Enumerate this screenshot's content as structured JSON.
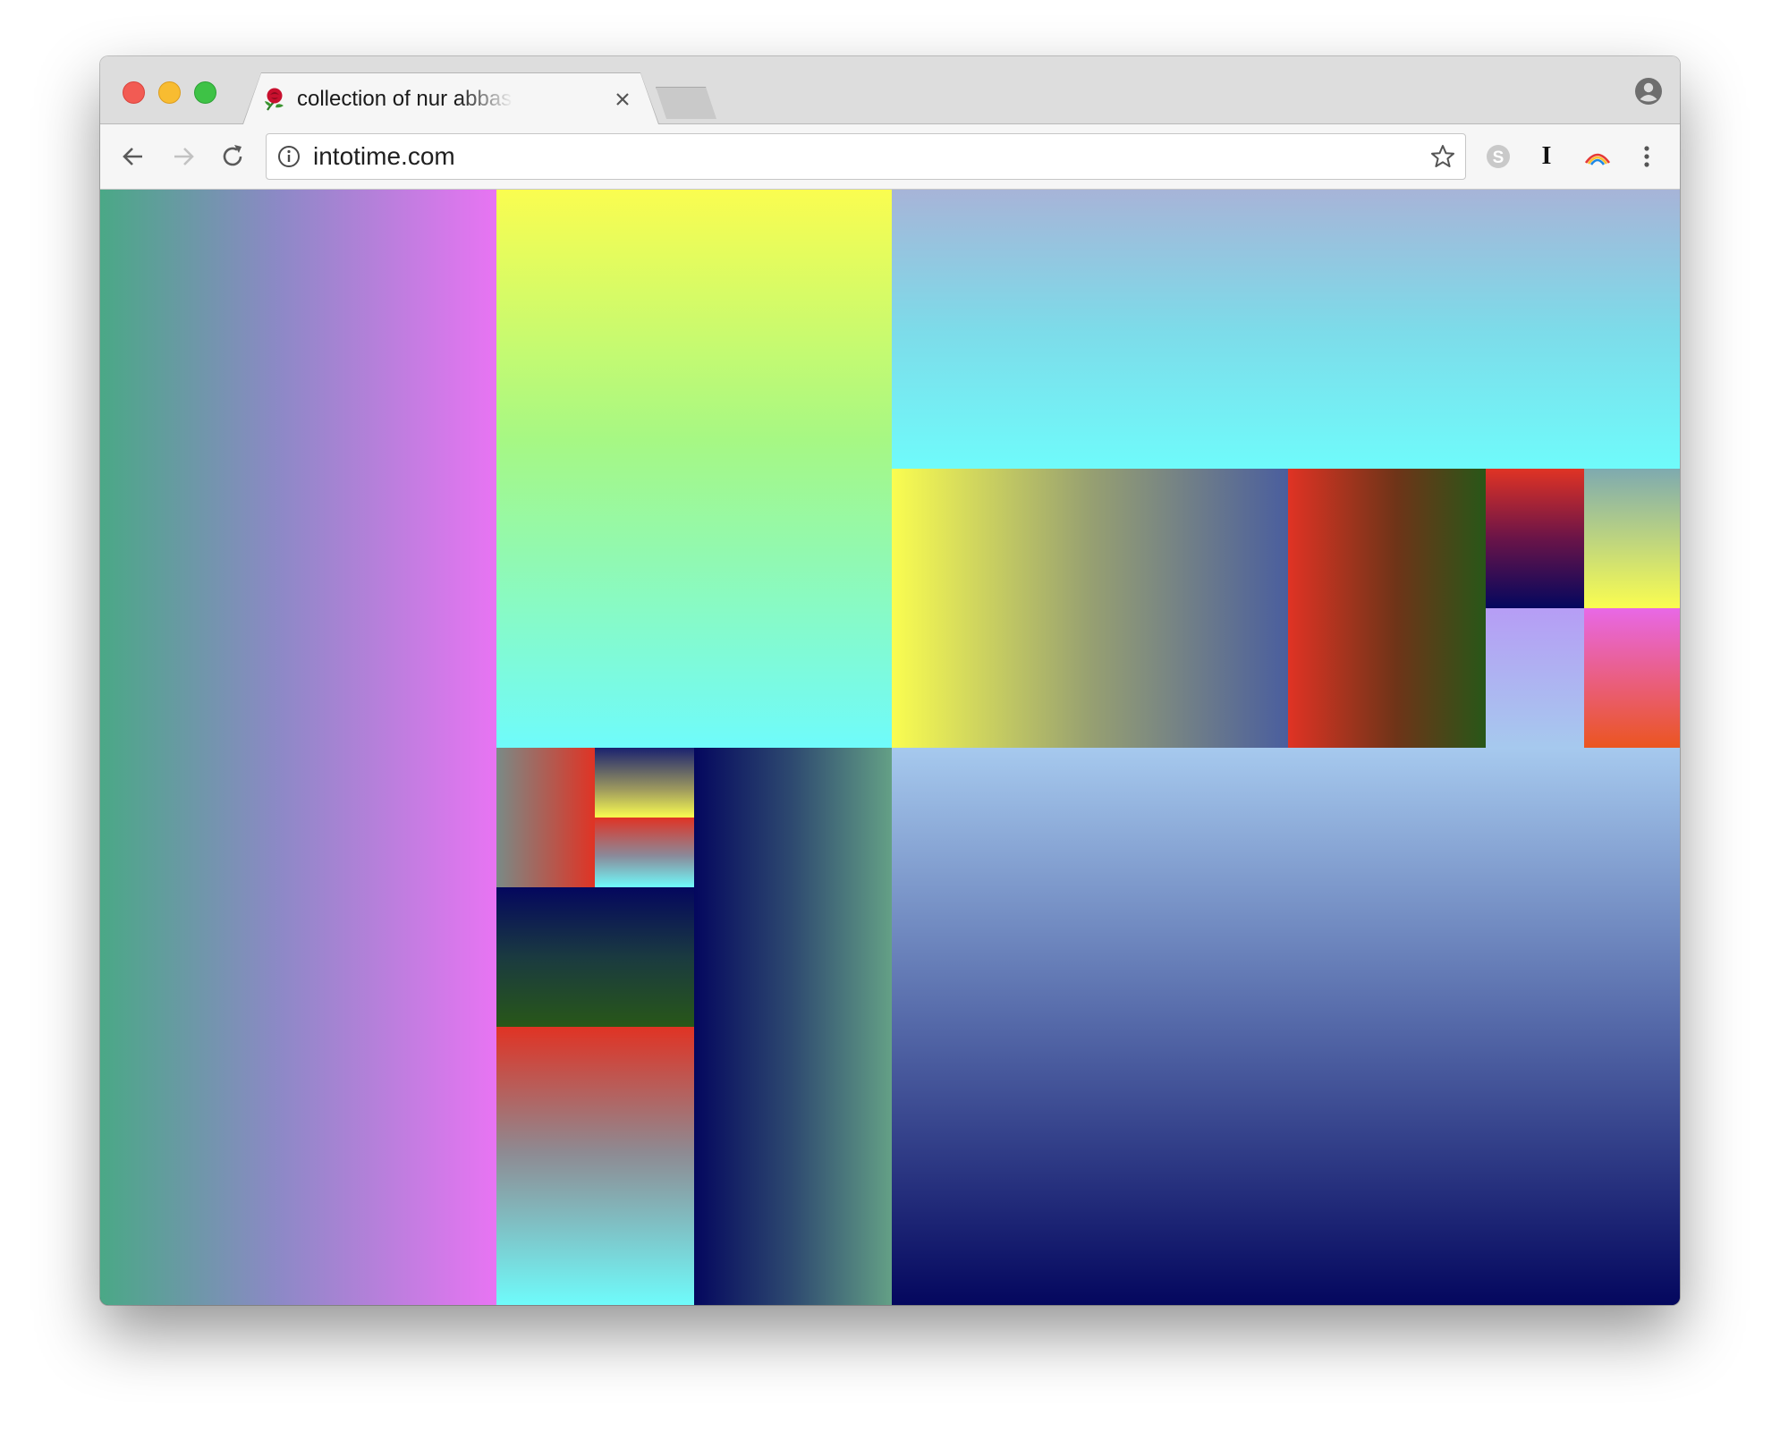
{
  "browser": {
    "tab": {
      "title": "collection of nur abbas, into time",
      "favicon": "rose-icon"
    },
    "address_bar": {
      "url": "intotime.com",
      "info_icon": "info-icon",
      "bookmark_icon": "star-icon"
    },
    "nav": {
      "back_icon": "arrow-left-icon",
      "forward_icon": "arrow-right-icon",
      "reload_icon": "reload-icon"
    },
    "extensions": [
      {
        "name": "skype-icon"
      },
      {
        "name": "instapaper-icon",
        "glyph": "I"
      },
      {
        "name": "rainbow-extension-icon"
      }
    ],
    "menu_icon": "kebab-menu-icon",
    "profile_icon": "profile-icon"
  },
  "page": {
    "colors": {
      "pink": "#e874f3",
      "teal": "#4aa886",
      "yellow": "#fafd50",
      "cyan": "#6ffbfb",
      "sky": "#a7b4d8",
      "red": "#e03324",
      "darkgreen": "#285718",
      "navy": "#04075e",
      "lavender": "#b69df5",
      "orange": "#eb5520"
    }
  }
}
